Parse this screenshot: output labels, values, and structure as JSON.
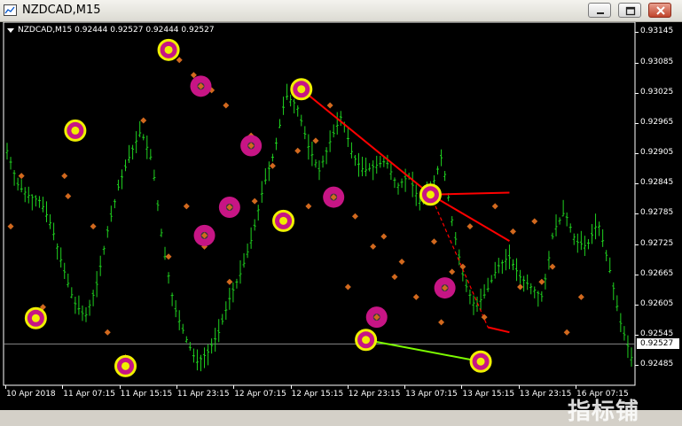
{
  "window": {
    "title": "NZDCAD,M15",
    "buttons": [
      "minimize-icon",
      "restore-icon",
      "close-icon"
    ]
  },
  "chart": {
    "symbol_label": "NZDCAD,M15",
    "ohlc_label": "0.92444 0.92527 0.92444 0.92527",
    "current_price": "0.92527",
    "price_labels": [
      "0.93145",
      "0.93085",
      "0.93025",
      "0.92965",
      "0.92905",
      "0.92845",
      "0.92785",
      "0.92725",
      "0.92665",
      "0.92605",
      "0.92545",
      "0.92485"
    ],
    "time_labels": [
      "10 Apr 2018",
      "11 Apr 07:15",
      "11 Apr 15:15",
      "11 Apr 23:15",
      "12 Apr 07:15",
      "12 Apr 15:15",
      "12 Apr 23:15",
      "13 Apr 07:15",
      "13 Apr 15:15",
      "13 Apr 23:15",
      "16 Apr 07:15"
    ],
    "watermark": "指标铺",
    "colors": {
      "background": "#000000",
      "bars": "#1fd11f",
      "fractal": "#d2691e",
      "yellow_ring": "#f0f000",
      "magenta_ring": "#c71585",
      "trendline_red": "#ff0000",
      "trendline_green": "#7cfc00",
      "axis_text": "#ffffff"
    }
  },
  "chart_data": {
    "type": "candlestick",
    "symbol": "NZDCAD",
    "timeframe": "M15",
    "ylim": [
      0.92445,
      0.93165
    ],
    "current_price": 0.92527,
    "ohlc_last": {
      "open": 0.92444,
      "high": 0.92527,
      "low": 0.92444,
      "close": 0.92527
    },
    "x_tick_labels": [
      "10 Apr 2018",
      "11 Apr 07:15",
      "11 Apr 15:15",
      "11 Apr 23:15",
      "12 Apr 07:15",
      "12 Apr 15:15",
      "12 Apr 23:15",
      "13 Apr 07:15",
      "13 Apr 15:15",
      "13 Apr 23:15",
      "16 Apr 07:15"
    ],
    "y_tick_labels": [
      "0.93145",
      "0.93085",
      "0.93025",
      "0.92965",
      "0.92905",
      "0.92845",
      "0.92785",
      "0.92725",
      "0.92665",
      "0.92605",
      "0.92545",
      "0.92485"
    ],
    "close_path": [
      [
        0,
        0.9291
      ],
      [
        1,
        0.9284
      ],
      [
        2,
        0.9282
      ],
      [
        3,
        0.9281
      ],
      [
        4,
        0.9276
      ],
      [
        5,
        0.9268
      ],
      [
        6,
        0.9261
      ],
      [
        7,
        0.9258
      ],
      [
        8,
        0.9264
      ],
      [
        9,
        0.9275
      ],
      [
        10,
        0.9284
      ],
      [
        11,
        0.929
      ],
      [
        12,
        0.9295
      ],
      [
        13,
        0.9289
      ],
      [
        14,
        0.9272
      ],
      [
        15,
        0.926
      ],
      [
        16,
        0.9254
      ],
      [
        17,
        0.9249
      ],
      [
        18,
        0.9251
      ],
      [
        19,
        0.9255
      ],
      [
        20,
        0.9262
      ],
      [
        21,
        0.9267
      ],
      [
        22,
        0.9274
      ],
      [
        23,
        0.9284
      ],
      [
        24,
        0.9291
      ],
      [
        25,
        0.9302
      ],
      [
        26,
        0.93
      ],
      [
        27,
        0.9292
      ],
      [
        28,
        0.9287
      ],
      [
        29,
        0.9293
      ],
      [
        30,
        0.9298
      ],
      [
        31,
        0.929
      ],
      [
        32,
        0.9287
      ],
      [
        33,
        0.9288
      ],
      [
        34,
        0.9289
      ],
      [
        35,
        0.9284
      ],
      [
        36,
        0.9286
      ],
      [
        37,
        0.9281
      ],
      [
        38,
        0.9283
      ],
      [
        39,
        0.929
      ],
      [
        40,
        0.9276
      ],
      [
        41,
        0.9265
      ],
      [
        42,
        0.926
      ],
      [
        43,
        0.9263
      ],
      [
        44,
        0.9268
      ],
      [
        45,
        0.927
      ],
      [
        46,
        0.9266
      ],
      [
        47,
        0.9264
      ],
      [
        48,
        0.9262
      ],
      [
        49,
        0.9275
      ],
      [
        50,
        0.9279
      ],
      [
        51,
        0.9273
      ],
      [
        52,
        0.9272
      ],
      [
        53,
        0.9277
      ],
      [
        54,
        0.9268
      ],
      [
        55,
        0.9257
      ],
      [
        56,
        0.925
      ]
    ],
    "fractals_high": [
      [
        4,
        0.9286
      ],
      [
        16,
        0.9286
      ],
      [
        24,
        0.9276
      ],
      [
        38,
        0.9297
      ],
      [
        48,
        0.9309
      ],
      [
        52,
        0.9306
      ],
      [
        57,
        0.9303
      ],
      [
        61,
        0.93
      ],
      [
        68,
        0.9294
      ],
      [
        74,
        0.9288
      ],
      [
        81,
        0.9291
      ],
      [
        86,
        0.9293
      ],
      [
        90,
        0.93
      ],
      [
        97,
        0.9278
      ],
      [
        105,
        0.9274
      ],
      [
        110,
        0.9269
      ],
      [
        119,
        0.9273
      ],
      [
        124,
        0.9267
      ],
      [
        129,
        0.9276
      ],
      [
        136,
        0.928
      ],
      [
        141,
        0.9275
      ],
      [
        147,
        0.9277
      ],
      [
        152,
        0.9268
      ],
      [
        160,
        0.9262
      ]
    ],
    "fractals_low": [
      [
        1,
        0.9276
      ],
      [
        10,
        0.926
      ],
      [
        17,
        0.9282
      ],
      [
        28,
        0.9255
      ],
      [
        33,
        0.925
      ],
      [
        45,
        0.927
      ],
      [
        50,
        0.928
      ],
      [
        55,
        0.9272
      ],
      [
        62,
        0.9265
      ],
      [
        69,
        0.9281
      ],
      [
        79,
        0.9278
      ],
      [
        84,
        0.928
      ],
      [
        95,
        0.9264
      ],
      [
        102,
        0.9272
      ],
      [
        108,
        0.9266
      ],
      [
        114,
        0.9262
      ],
      [
        121,
        0.9257
      ],
      [
        127,
        0.9268
      ],
      [
        133,
        0.9258
      ],
      [
        143,
        0.9264
      ],
      [
        149,
        0.9265
      ],
      [
        156,
        0.9255
      ]
    ],
    "rings_yellow": [
      [
        8,
        0.92578
      ],
      [
        19,
        0.9295
      ],
      [
        33,
        0.92483
      ],
      [
        45,
        0.9311
      ],
      [
        77,
        0.92771
      ],
      [
        82,
        0.93032
      ],
      [
        100,
        0.92535
      ],
      [
        118,
        0.92823
      ],
      [
        132,
        0.92492
      ]
    ],
    "rings_magenta": [
      [
        54,
        0.93038
      ],
      [
        55,
        0.92742
      ],
      [
        62,
        0.92798
      ],
      [
        68,
        0.9292
      ],
      [
        91,
        0.92818
      ],
      [
        103,
        0.9258
      ],
      [
        122,
        0.92638
      ]
    ],
    "trendlines": [
      {
        "color": "red",
        "from": [
          82,
          0.93032
        ],
        "to": [
          118,
          0.92823
        ]
      },
      {
        "color": "red",
        "from": [
          118,
          0.92823
        ],
        "to": [
          140,
          0.92731
        ]
      },
      {
        "color": "red",
        "from": [
          118,
          0.92823
        ],
        "to": [
          140,
          0.92827
        ]
      },
      {
        "color": "red",
        "from": [
          118,
          0.92823
        ],
        "to": [
          134,
          0.9256
        ],
        "dashed": true
      },
      {
        "color": "red",
        "from": [
          134,
          0.9256
        ],
        "to": [
          140,
          0.9255
        ]
      },
      {
        "color": "green",
        "from": [
          100,
          0.92535
        ],
        "to": [
          132,
          0.92492
        ]
      }
    ]
  }
}
